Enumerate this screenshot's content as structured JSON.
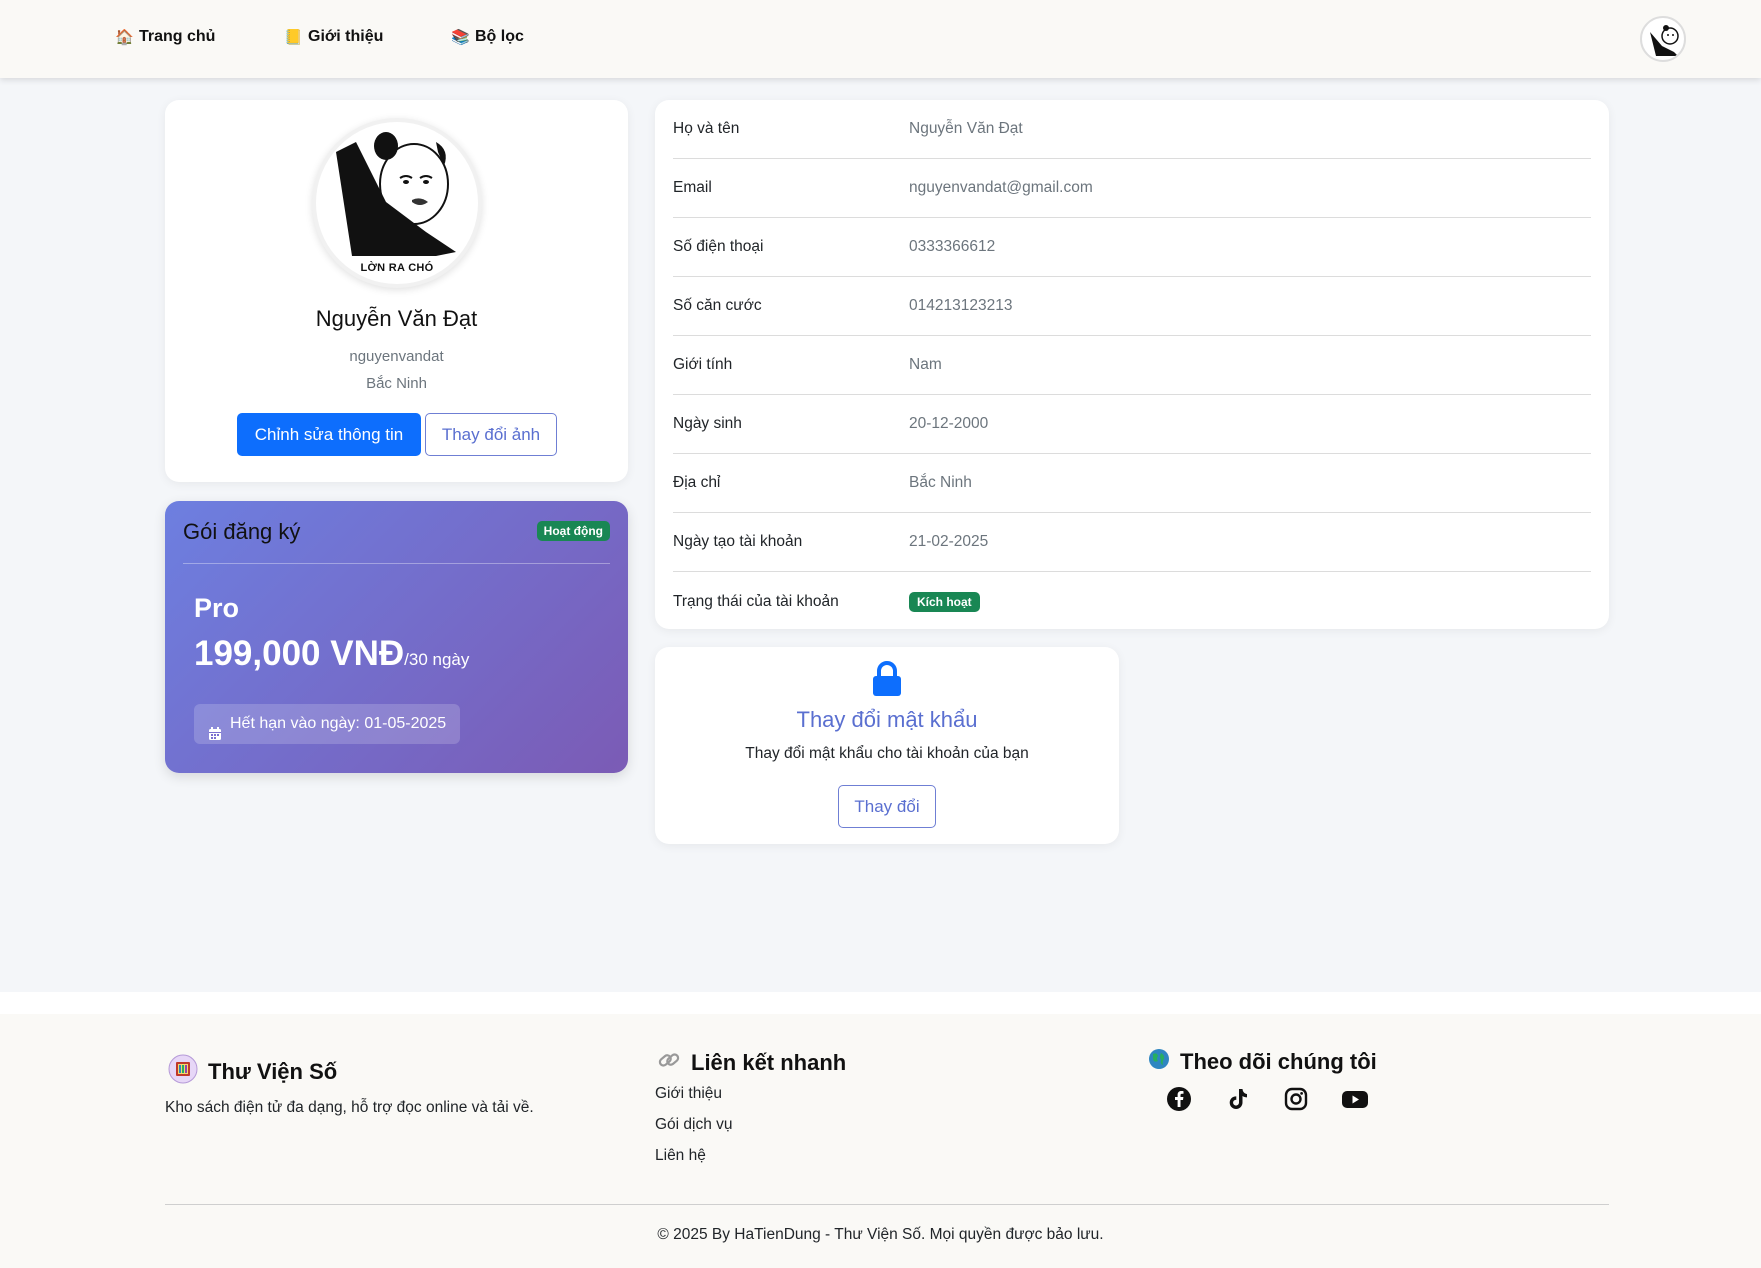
{
  "nav": {
    "items": [
      {
        "icon": "🏠",
        "label": "Trang chủ"
      },
      {
        "icon": "📒",
        "label": "Giới thiệu"
      },
      {
        "icon": "📚",
        "label": "Bộ lọc"
      }
    ]
  },
  "profile": {
    "avatar_caption": "LỜN RA CHÓ",
    "name": "Nguyễn Văn Đạt",
    "username": "nguyenvandat",
    "city": "Bắc Ninh",
    "edit_button": "Chỉnh sửa thông tin",
    "change_photo_button": "Thay đổi ảnh"
  },
  "subscription": {
    "title": "Gói đăng ký",
    "status": "Hoạt động",
    "plan": "Pro",
    "price": "199,000 VNĐ",
    "period": "/30 ngày",
    "expire": "Hết hạn vào ngày: 01-05-2025"
  },
  "info": {
    "rows": [
      {
        "label": "Họ và tên",
        "value": "Nguyễn Văn Đạt"
      },
      {
        "label": "Email",
        "value": "nguyenvandat@gmail.com"
      },
      {
        "label": "Số điện thoại",
        "value": "0333366612"
      },
      {
        "label": "Số căn cước",
        "value": "014213123213"
      },
      {
        "label": "Giới tính",
        "value": "Nam"
      },
      {
        "label": "Ngày sinh",
        "value": "20-12-2000"
      },
      {
        "label": "Địa chỉ",
        "value": "Bắc Ninh"
      },
      {
        "label": "Ngày tạo tài khoản",
        "value": "21-02-2025"
      }
    ],
    "status_label": "Trạng thái của tài khoản",
    "status_value": "Kích hoạt"
  },
  "password": {
    "title": "Thay đổi mật khẩu",
    "description": "Thay đổi mật khẩu cho tài khoản của bạn",
    "button": "Thay đổi"
  },
  "footer": {
    "brand": "Thư Viện Số",
    "brand_desc": "Kho sách điện tử đa dạng, hỗ trợ đọc online và tải về.",
    "links_title": "Liên kết nhanh",
    "links": [
      "Giới thiệu",
      "Gói dịch vụ",
      "Liên hệ"
    ],
    "follow_title": "Theo dõi chúng tôi",
    "social_icons": [
      "facebook-icon",
      "tiktok-icon",
      "instagram-icon",
      "youtube-icon"
    ],
    "copyright": "© 2025 By HaTienDung - Thư Viện Số. Mọi quyền được bảo lưu."
  },
  "colors": {
    "primary": "#0d6efd",
    "accent": "#5a6fd0",
    "success": "#198754",
    "gradient_start": "#6d7fe0",
    "gradient_end": "#7b5bb5"
  }
}
